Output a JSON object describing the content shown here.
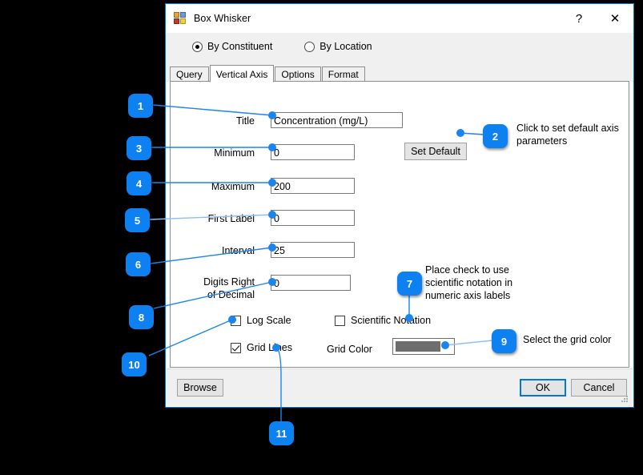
{
  "window": {
    "title": "Box Whisker",
    "icon": "forms-grid-icon",
    "help_label": "?",
    "close_label": "✕"
  },
  "options": {
    "radios": [
      {
        "label": "By Constituent",
        "selected": true
      },
      {
        "label": "By Location",
        "selected": false
      }
    ]
  },
  "tabs": [
    {
      "label": "Query",
      "active": false
    },
    {
      "label": "Vertical Axis",
      "active": true
    },
    {
      "label": "Options",
      "active": false
    },
    {
      "label": "Format",
      "active": false
    }
  ],
  "form": {
    "title_label": "Title",
    "title_value": "Concentration (mg/L)",
    "minimum_label": "Minimum",
    "minimum_value": "0",
    "maximum_label": "Maximum",
    "maximum_value": "200",
    "first_label_label": "First Label",
    "first_label_value": "0",
    "interval_label": "Interval",
    "interval_value": "25",
    "digits_label_line1": "Digits Right",
    "digits_label_line2": "of Decimal",
    "digits_value": "0",
    "set_default_label": "Set Default",
    "log_scale_label": "Log Scale",
    "log_scale_checked": false,
    "scientific_label": "Scientific Notation",
    "scientific_checked": false,
    "grid_lines_label": "Grid Lines",
    "grid_lines_checked": true,
    "grid_color_label": "Grid Color",
    "grid_color_value": "#6e6e6e",
    "grid_color_arrow": "⌄"
  },
  "footer": {
    "browse_label": "Browse",
    "ok_label": "OK",
    "cancel_label": "Cancel"
  },
  "annotations": [
    {
      "number": "1",
      "text": ""
    },
    {
      "number": "2",
      "text": "Click to set default axis\nparameters"
    },
    {
      "number": "3",
      "text": ""
    },
    {
      "number": "4",
      "text": ""
    },
    {
      "number": "5",
      "text": ""
    },
    {
      "number": "6",
      "text": ""
    },
    {
      "number": "7",
      "text": "Place check to use\nscientific notation in\nnumeric axis labels"
    },
    {
      "number": "8",
      "text": ""
    },
    {
      "number": "9",
      "text": "Select the grid color"
    },
    {
      "number": "10",
      "text": ""
    },
    {
      "number": "11",
      "text": ""
    }
  ],
  "colors": {
    "accent": "#0d81f2",
    "dialog_border": "#0078d7",
    "panel": "#f0f0f0",
    "backdrop": "#000000"
  }
}
